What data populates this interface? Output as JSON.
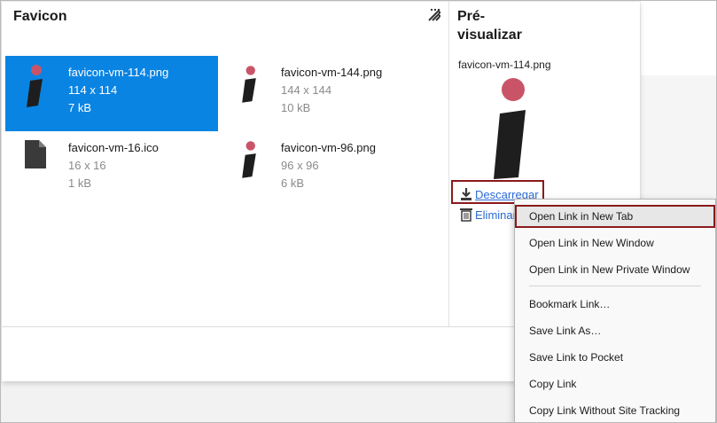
{
  "favicon_panel": {
    "title": "Favicon",
    "items": [
      {
        "name": "favicon-vm-114.png",
        "dims": "114 x 114",
        "size": "7 kB"
      },
      {
        "name": "favicon-vm-144.png",
        "dims": "144 x 144",
        "size": "10 kB"
      },
      {
        "name": "favicon-vm-16.ico",
        "dims": "16 x 16",
        "size": "1 kB"
      },
      {
        "name": "favicon-vm-96.png",
        "dims": "96 x 96",
        "size": "6 kB"
      }
    ],
    "selected_index": 0
  },
  "preview": {
    "title_line1": "Pré-",
    "title_line2": "visualizar",
    "file_name": "favicon-vm-114.png",
    "download_label": "Descarregar",
    "delete_label": "Eliminar"
  },
  "context_menu": {
    "items": [
      {
        "label": "Open Link in New Tab",
        "highlighted": true
      },
      {
        "label": "Open Link in New Window"
      },
      {
        "label": "Open Link in New Private Window"
      },
      {
        "separator": true
      },
      {
        "label": "Bookmark Link…"
      },
      {
        "label": "Save Link As…"
      },
      {
        "label": "Save Link to Pocket"
      },
      {
        "label": "Copy Link"
      },
      {
        "label": "Copy Link Without Site Tracking"
      }
    ]
  },
  "colors": {
    "selection": "#0a84e2",
    "link": "#2a6bd5",
    "highlight_border": "#8b1a1a",
    "logo_dot": "#c95468",
    "logo_stem": "#1e1e1e"
  }
}
